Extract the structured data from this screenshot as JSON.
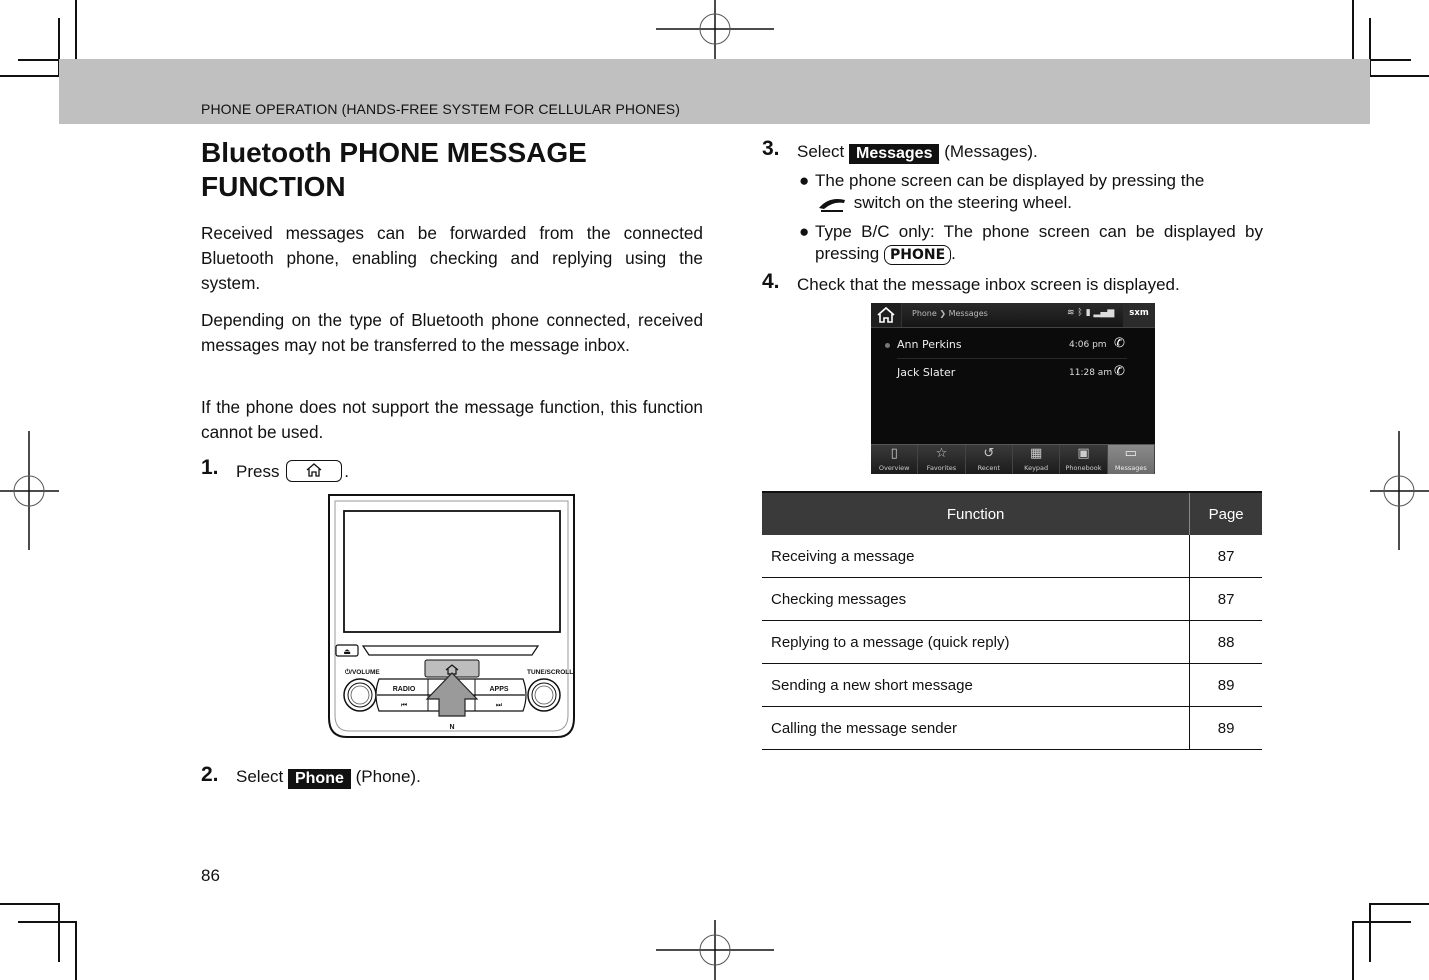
{
  "header": {
    "section_title": "PHONE OPERATION (HANDS-FREE SYSTEM FOR CELLULAR PHONES)",
    "band_color": "#c0c0c0"
  },
  "left_column": {
    "title": "Bluetooth PHONE MESSAGE FUNCTION",
    "paragraphs": [
      "Received messages can be forwarded from the connected Bluetooth phone, enabling checking and replying using the system.",
      "Depending on the type of Bluetooth phone connected, received messages may not be transferred to the message inbox.",
      "If the phone does not support the message function, this function cannot be used."
    ],
    "steps": [
      {
        "number": "1.",
        "prefix": "Press",
        "key_icon": "home-icon",
        "suffix": "."
      },
      {
        "number": "2.",
        "prefix": "Select",
        "button": "Phone",
        "suffix": "(Phone)."
      }
    ],
    "head_unit": {
      "labels": {
        "volume": "⏻/VOLUME",
        "tune": "TUNE/SCROLL",
        "radio": "RADIO",
        "apps": "APPS",
        "prev": "⏮",
        "next": "⏭",
        "eject": "⏏",
        "nfc": "N"
      }
    }
  },
  "right_column": {
    "steps": [
      {
        "number": "3.",
        "prefix": "Select",
        "button": "Messages",
        "suffix": "(Messages)."
      },
      {
        "number": "4.",
        "text": "Check that the message inbox screen is displayed."
      }
    ],
    "bullets": [
      {
        "text_before": "The phone screen can be displayed by pressing the",
        "icon": "phone-handset-icon",
        "text_after": "switch on the steering wheel."
      },
      {
        "text_before": "Type B/C only: The phone screen can be displayed by pressing",
        "key": "PHONE",
        "text_after": "."
      }
    ],
    "phone_screen": {
      "breadcrumb": "Phone ❯ Messages",
      "status_icons": "wifi bluetooth battery signal",
      "sxm_label": "sxm",
      "messages": [
        {
          "name": "Ann Perkins",
          "time": "4:06 pm",
          "unread": true
        },
        {
          "name": "Jack Slater",
          "time": "11:28 am",
          "unread": false
        }
      ],
      "tabs": [
        {
          "label": "Overview",
          "icon": "▯",
          "active": false
        },
        {
          "label": "Favorites",
          "icon": "☆",
          "active": false
        },
        {
          "label": "Recent",
          "icon": "↺",
          "active": false
        },
        {
          "label": "Keypad",
          "icon": "▦",
          "active": false
        },
        {
          "label": "Phonebook",
          "icon": "▣",
          "active": false
        },
        {
          "label": "Messages",
          "icon": "▭",
          "active": true
        }
      ]
    },
    "table": {
      "headers": [
        "Function",
        "Page"
      ],
      "rows": [
        {
          "function": "Receiving a message",
          "page": "87"
        },
        {
          "function": "Checking messages",
          "page": "87"
        },
        {
          "function": "Replying to a message (quick reply)",
          "page": "88"
        },
        {
          "function": "Sending a new short message",
          "page": "89"
        },
        {
          "function": "Calling the message sender",
          "page": "89"
        }
      ]
    }
  },
  "footer": {
    "page_number": "86"
  }
}
